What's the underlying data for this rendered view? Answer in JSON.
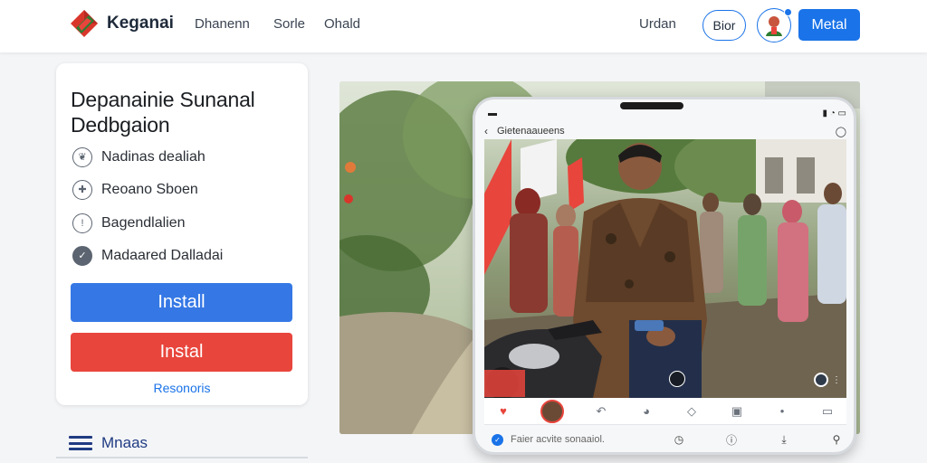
{
  "header": {
    "brand": "Keganai",
    "nav": [
      "Dhanenn",
      "Sorle",
      "Ohald"
    ],
    "right_link": "Urdan",
    "outline_button": "Bior",
    "install_button": "Metal"
  },
  "card": {
    "title": "Depanainie Sunanal Dedbgaion",
    "features": [
      {
        "label": "Nadinas dealiah",
        "icon": "leaf-icon"
      },
      {
        "label": "Reoano Sboen",
        "icon": "shield-icon"
      },
      {
        "label": "Bagendlalien",
        "icon": "info-icon"
      },
      {
        "label": "Madaared Dalladai",
        "icon": "check-icon"
      }
    ],
    "primary_button": "Install",
    "secondary_button": "Instal",
    "link": "Resonoris"
  },
  "menu": {
    "label": "Mnaas"
  },
  "phone": {
    "app_title": "Gietenaaueens",
    "bottom_text": "Faier acvite sonaaiol."
  },
  "colors": {
    "accent": "#1a73e8",
    "primary_button": "#3578e5",
    "secondary_button": "#e8453c",
    "logo_red": "#d9362b",
    "logo_green": "#2f7d32",
    "menu_navy": "#1f3b82"
  }
}
